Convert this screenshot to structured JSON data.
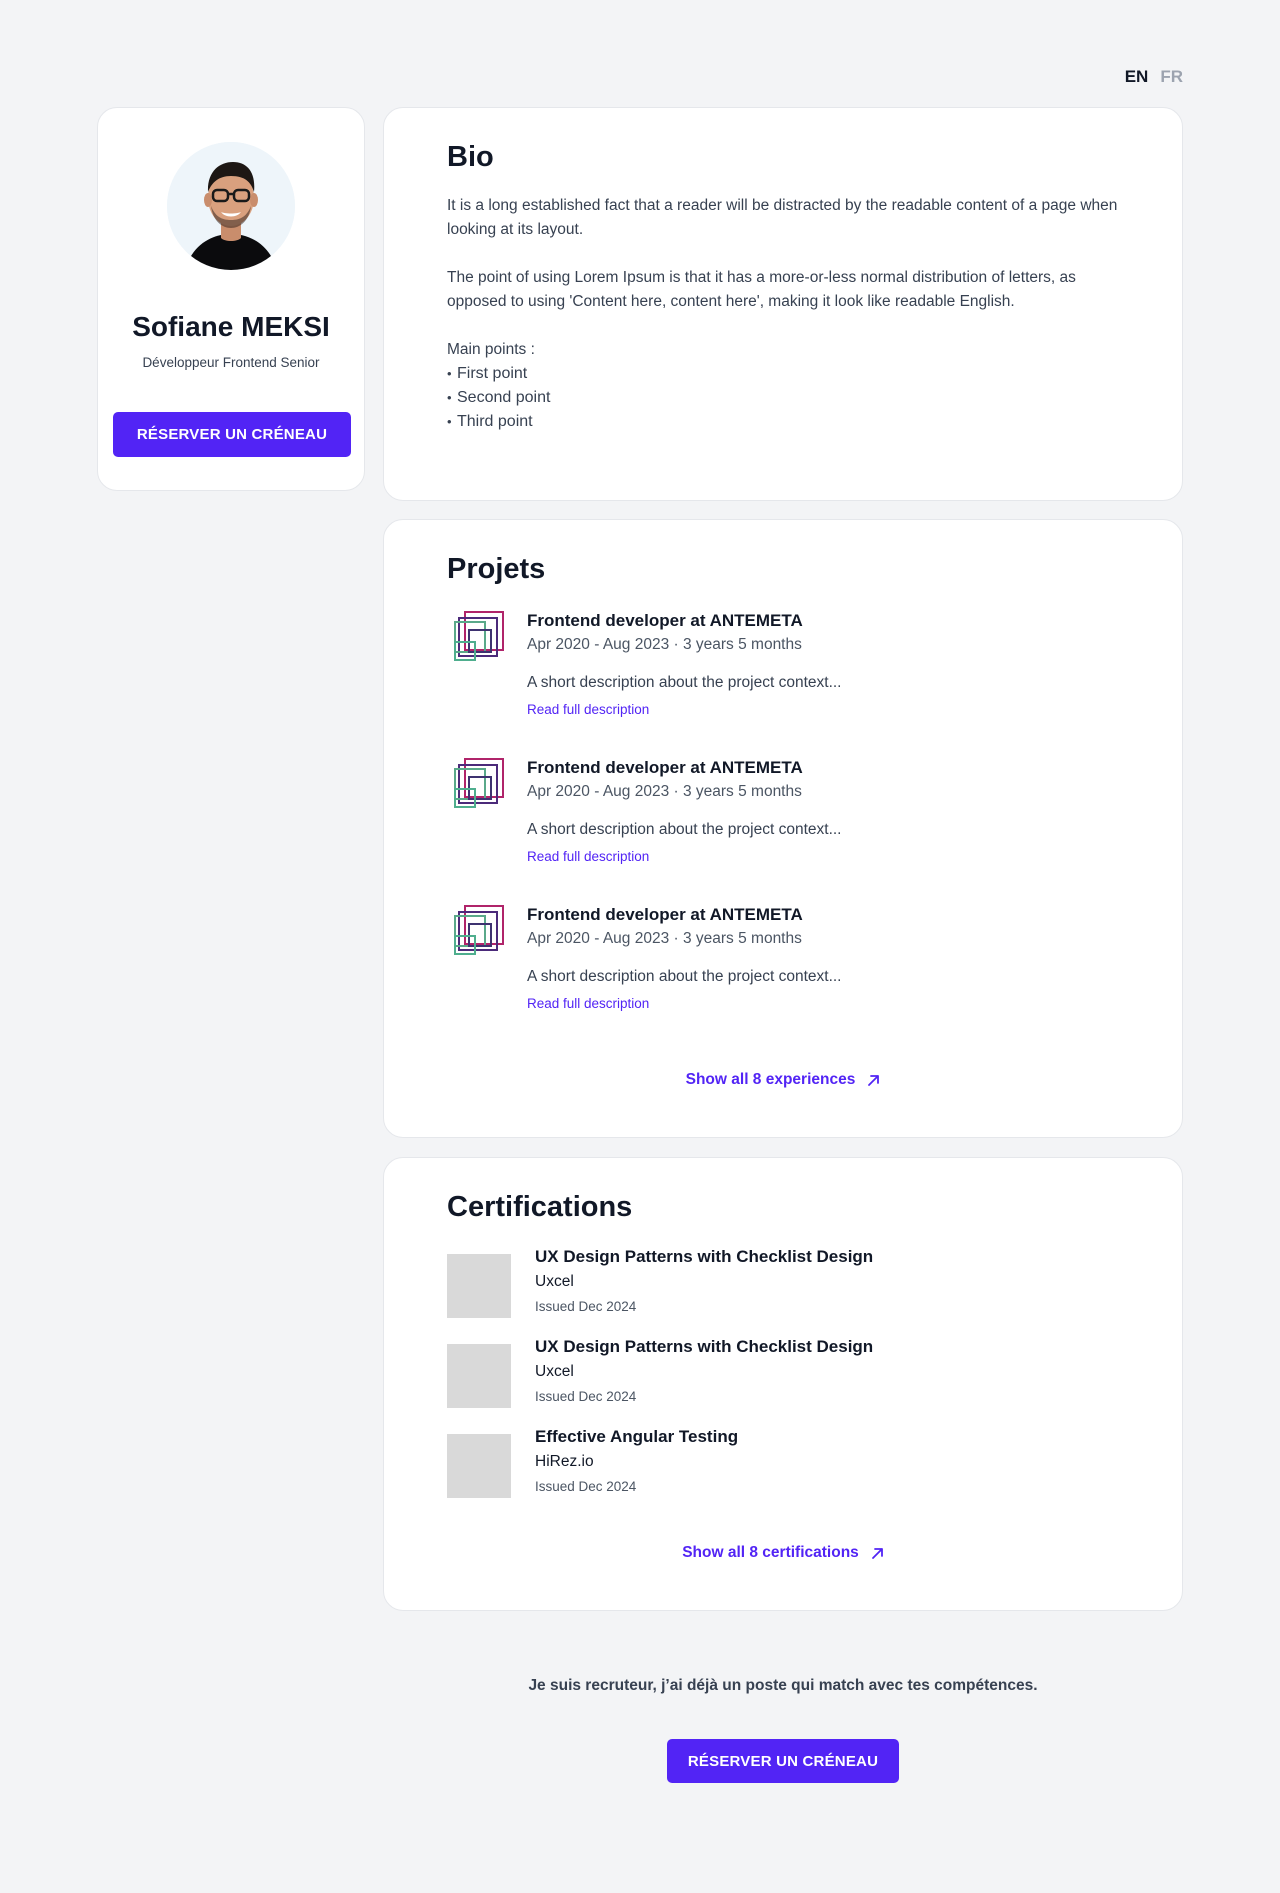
{
  "lang": {
    "en": "EN",
    "fr": "FR",
    "active": "EN"
  },
  "profile": {
    "name": "Sofiane MEKSI",
    "role": "Développeur Frontend Senior",
    "cta_label": "RÉSERVER UN CRÉNEAU"
  },
  "bio": {
    "title": "Bio",
    "paragraph_1": "It is a long established fact that a reader will be distracted by the readable content of a page when looking at its layout.",
    "paragraph_2": "The point of using Lorem Ipsum is that it has a more-or-less normal distribution of letters, as opposed to using 'Content here, content here', making it look like readable English.",
    "points_label": "Main points :",
    "points": [
      "First point",
      "Second point",
      "Third point"
    ]
  },
  "projects": {
    "title": "Projets",
    "items": [
      {
        "title": "Frontend developer at ANTEMETA",
        "dates": "Apr 2020 - Aug 2023 · 3 years 5 months",
        "description": "A short description about the project context...",
        "link": "Read full description"
      },
      {
        "title": "Frontend developer at ANTEMETA",
        "dates": "Apr 2020 - Aug 2023 · 3 years 5 months",
        "description": "A short description about the project context...",
        "link": "Read full description"
      },
      {
        "title": "Frontend developer at ANTEMETA",
        "dates": "Apr 2020 - Aug 2023 · 3 years 5 months",
        "description": "A short description about the project context...",
        "link": "Read full description"
      }
    ],
    "show_all": "Show all 8 experiences"
  },
  "certifications": {
    "title": "Certifications",
    "items": [
      {
        "title": "UX Design Patterns with Checklist Design",
        "issuer": "Uxcel",
        "date": "Issued Dec 2024"
      },
      {
        "title": "UX Design Patterns with Checklist Design",
        "issuer": "Uxcel",
        "date": "Issued Dec 2024"
      },
      {
        "title": "Effective Angular Testing",
        "issuer": "HiRez.io",
        "date": "Issued Dec 2024"
      }
    ],
    "show_all": "Show all 8 certifications"
  },
  "footer": {
    "text": "Je suis recruteur, j’ai déjà un poste qui match avec tes compétences.",
    "cta_label": "RÉSERVER UN CRÉNEAU"
  },
  "colors": {
    "accent": "#5224f5",
    "background": "#f3f4f6",
    "card": "#ffffff"
  },
  "icons": {
    "arrow": "arrow-up-right-icon",
    "company_logo": "antemeta-logo-icon"
  }
}
